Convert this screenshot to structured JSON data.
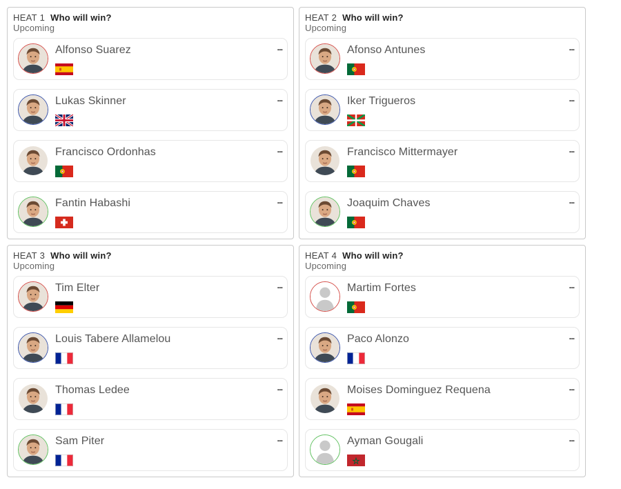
{
  "heats": [
    {
      "title": "HEAT 1",
      "question": "Who will win?",
      "status": "Upcoming",
      "athletes": [
        {
          "name": "Alfonso Suarez",
          "score": "--",
          "flag": "spain-flag-icon",
          "ring": "#d44a45",
          "photo": "photo"
        },
        {
          "name": "Lukas Skinner",
          "score": "--",
          "flag": "uk-flag-icon",
          "ring": "#3550a8",
          "photo": "photo"
        },
        {
          "name": "Francisco Ordonhas",
          "score": "--",
          "flag": "portugal-flag-icon",
          "ring": "#ffffff",
          "photo": "photo"
        },
        {
          "name": "Fantin Habashi",
          "score": "--",
          "flag": "switzerland-flag-icon",
          "ring": "#5cbf5c",
          "photo": "photo"
        }
      ]
    },
    {
      "title": "HEAT 2",
      "question": "Who will win?",
      "status": "Upcoming",
      "athletes": [
        {
          "name": "Afonso Antunes",
          "score": "--",
          "flag": "portugal-flag-icon",
          "ring": "#d44a45",
          "photo": "photo"
        },
        {
          "name": "Iker Trigueros",
          "score": "--",
          "flag": "basque-flag-icon",
          "ring": "#3550a8",
          "photo": "photo"
        },
        {
          "name": "Francisco Mittermayer",
          "score": "--",
          "flag": "portugal-flag-icon",
          "ring": "#ffffff",
          "photo": "photo"
        },
        {
          "name": "Joaquim Chaves",
          "score": "--",
          "flag": "portugal-flag-icon",
          "ring": "#5cbf5c",
          "photo": "photo"
        }
      ]
    },
    {
      "title": "HEAT 3",
      "question": "Who will win?",
      "status": "Upcoming",
      "athletes": [
        {
          "name": "Tim Elter",
          "score": "--",
          "flag": "germany-flag-icon",
          "ring": "#d44a45",
          "photo": "photo"
        },
        {
          "name": "Louis Tabere Allamelou",
          "score": "--",
          "flag": "france-flag-icon",
          "ring": "#3550a8",
          "photo": "photo"
        },
        {
          "name": "Thomas Ledee",
          "score": "--",
          "flag": "france-flag-icon",
          "ring": "#ffffff",
          "photo": "photo"
        },
        {
          "name": "Sam Piter",
          "score": "--",
          "flag": "france-flag-icon",
          "ring": "#5cbf5c",
          "photo": "photo"
        }
      ]
    },
    {
      "title": "HEAT 4",
      "question": "Who will win?",
      "status": "Upcoming",
      "athletes": [
        {
          "name": "Martim Fortes",
          "score": "--",
          "flag": "portugal-flag-icon",
          "ring": "#d44a45",
          "photo": "placeholder"
        },
        {
          "name": "Paco Alonzo",
          "score": "--",
          "flag": "france-flag-icon",
          "ring": "#3550a8",
          "photo": "photo"
        },
        {
          "name": "Moises Dominguez Requena",
          "score": "--",
          "flag": "spain-flag-icon",
          "ring": "#ffffff",
          "photo": "photo"
        },
        {
          "name": "Ayman Gougali",
          "score": "--",
          "flag": "morocco-flag-icon",
          "ring": "#5cbf5c",
          "photo": "placeholder"
        }
      ]
    }
  ]
}
